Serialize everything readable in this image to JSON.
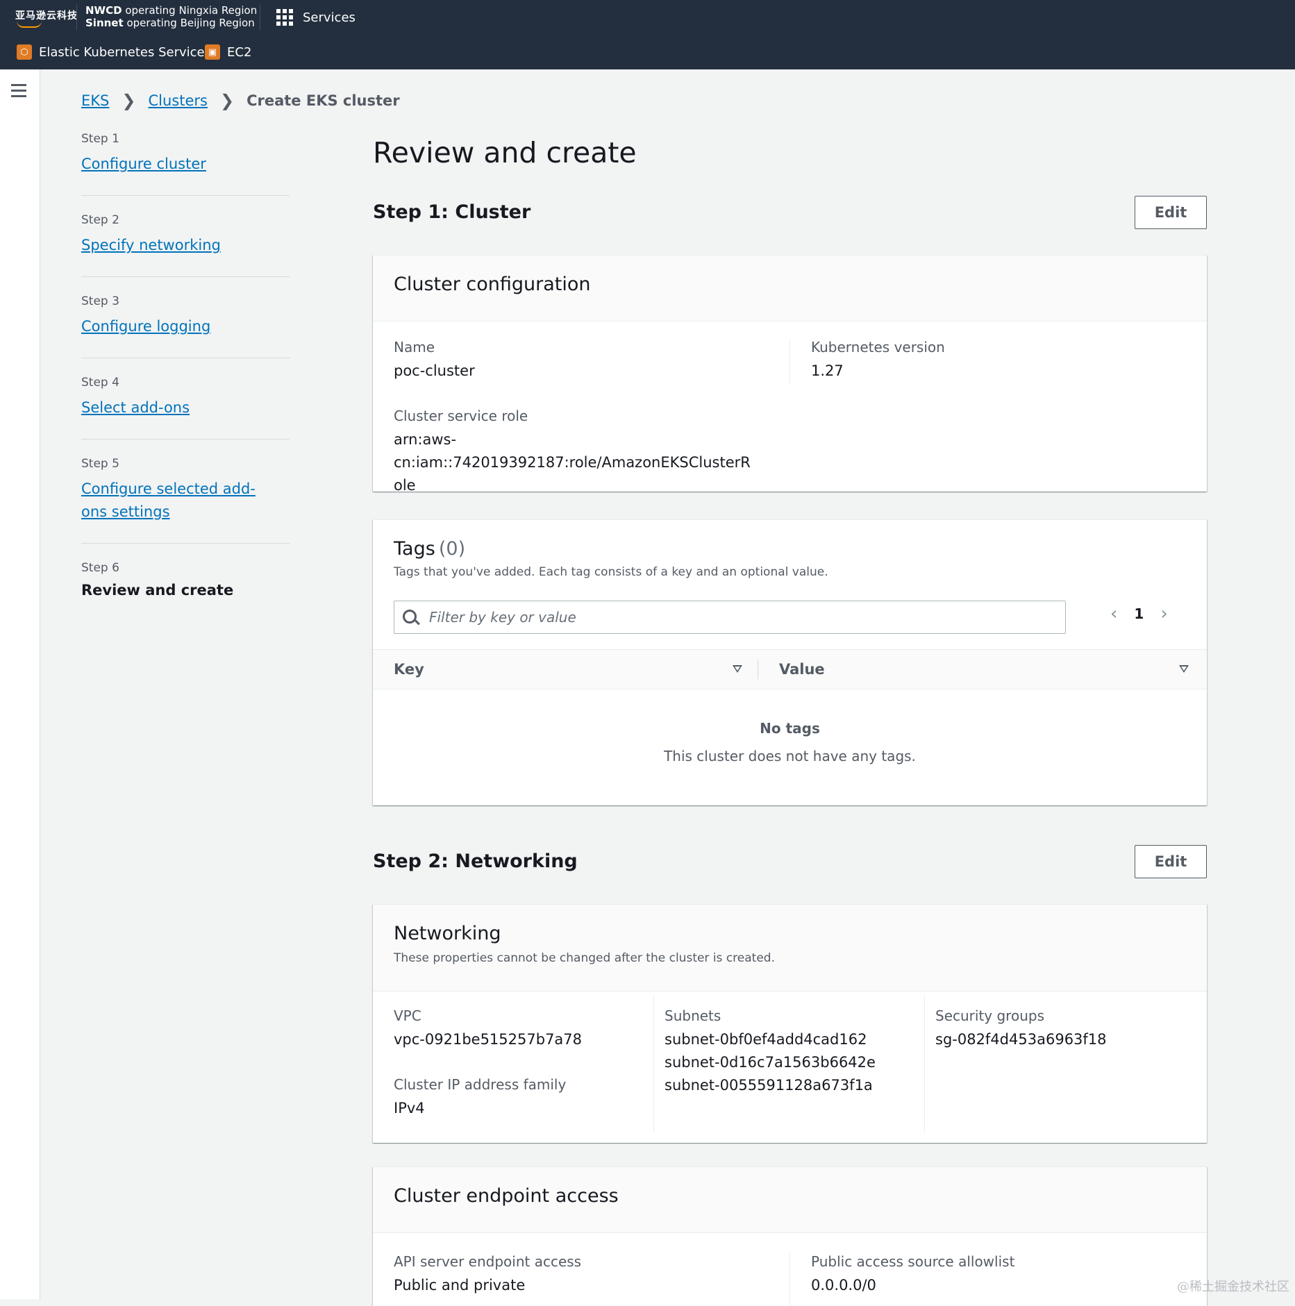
{
  "topnav": {
    "logo": "亚马逊云科技",
    "region_line1_bold": "NWCD",
    "region_line1_rest": "operating Ningxia Region",
    "region_line2_bold": "Sinnet",
    "region_line2_rest": "operating Beijing Region",
    "services_label": "Services",
    "favorites": [
      {
        "label": "Elastic Kubernetes Service",
        "icon": "eks-icon"
      },
      {
        "label": "EC2",
        "icon": "ec2-icon"
      }
    ]
  },
  "breadcrumb": {
    "items": [
      "EKS",
      "Clusters"
    ],
    "current": "Create EKS cluster"
  },
  "steps": [
    {
      "num": "Step 1",
      "label": "Configure cluster"
    },
    {
      "num": "Step 2",
      "label": "Specify networking"
    },
    {
      "num": "Step 3",
      "label": "Configure logging"
    },
    {
      "num": "Step 4",
      "label": "Select add-ons"
    },
    {
      "num": "Step 5",
      "label": "Configure selected add-ons settings"
    },
    {
      "num": "Step 6",
      "label": "Review and create"
    }
  ],
  "page_title": "Review and create",
  "edit_label": "Edit",
  "step1": {
    "heading": "Step 1: Cluster",
    "cluster_config": {
      "title": "Cluster configuration",
      "name_label": "Name",
      "name_value": "poc-cluster",
      "k8s_label": "Kubernetes version",
      "k8s_value": "1.27",
      "role_label": "Cluster service role",
      "role_value": "arn:aws-cn:iam::742019392187:role/AmazonEKSClusterRole"
    },
    "tags": {
      "title": "Tags",
      "count": "(0)",
      "description": "Tags that you've added. Each tag consists of a key and an optional value.",
      "filter_placeholder": "Filter by key or value",
      "page": "1",
      "col_key": "Key",
      "col_value": "Value",
      "empty_title": "No tags",
      "empty_desc": "This cluster does not have any tags."
    }
  },
  "step2": {
    "heading": "Step 2: Networking",
    "networking": {
      "title": "Networking",
      "description": "These properties cannot be changed after the cluster is created.",
      "vpc_label": "VPC",
      "vpc_value": "vpc-0921be515257b7a78",
      "ipfamily_label": "Cluster IP address family",
      "ipfamily_value": "IPv4",
      "subnets_label": "Subnets",
      "subnets": [
        "subnet-0bf0ef4add4cad162",
        "subnet-0d16c7a1563b6642e",
        "subnet-0055591128a673f1a"
      ],
      "sg_label": "Security groups",
      "sg_value": "sg-082f4d453a6963f18"
    },
    "endpoint": {
      "title": "Cluster endpoint access",
      "api_label": "API server endpoint access",
      "api_value": "Public and private",
      "allowlist_label": "Public access source allowlist",
      "allowlist_value": "0.0.0.0/0"
    }
  },
  "watermark": "@稀土掘金技术社区"
}
